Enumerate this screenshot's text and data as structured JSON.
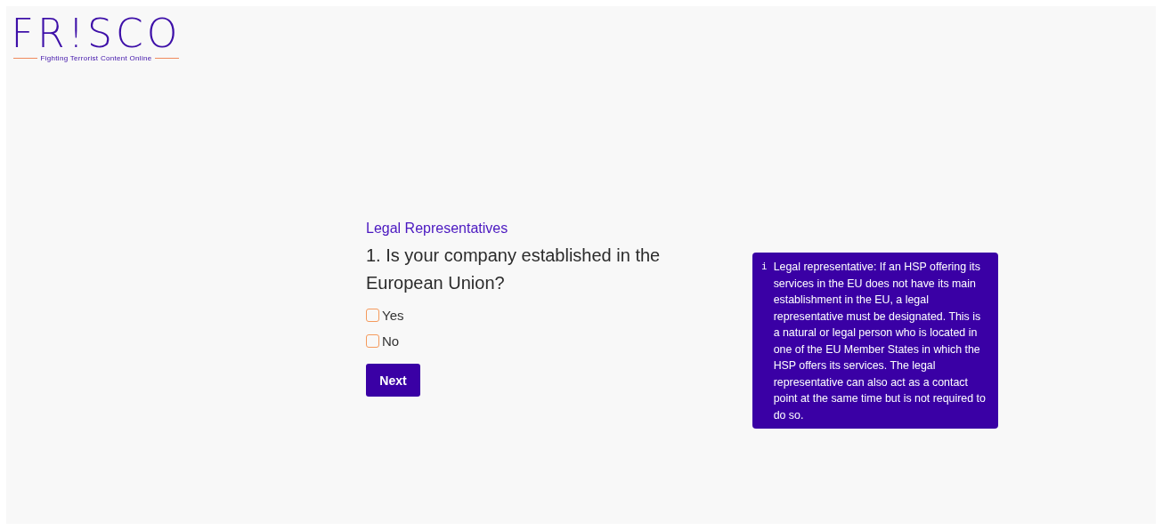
{
  "logo": {
    "name": "FR!SCO",
    "tagline": "Fighting Terrorist Content Online"
  },
  "form": {
    "section": "Legal Representatives",
    "question": "1. Is your company established in the European Union?",
    "options": [
      {
        "label": "Yes",
        "checked": false
      },
      {
        "label": "No",
        "checked": false
      }
    ],
    "button": "Next"
  },
  "info": {
    "icon": "i",
    "text": "Legal representative: If an HSP offering its services in the EU does not have its main establishment in the EU, a legal representative must be designated. This is a natural or legal person who is located in one of the EU Member States in which the HSP offers its services. The legal representative can also act as a contact point at the same time but is not required to do so."
  }
}
